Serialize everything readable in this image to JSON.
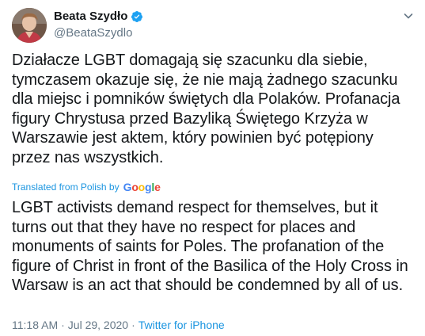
{
  "author": {
    "display_name": "Beata Szydło",
    "handle": "@BeataSzydlo"
  },
  "tweet": {
    "original_text": "Działacze LGBT domagają się szacunku dla siebie,\ntymczasem okazuje się, że nie mają żadnego szacunku\ndla miejsc i pomników świętych dla Polaków.   Profanacja\nfigury Chrystusa przed Bazyliką Świętego Krzyża w\nWarszawie jest aktem, który powinien być potępiony\nprzez nas wszystkich.",
    "translated_label": "Translated from Polish by",
    "translator_brand": "Google",
    "translated_text": "LGBT activists demand respect for themselves, but it\nturns out that they have no respect for places and\nmonuments of saints for Poles. The profanation of the\nfigure of Christ in front of the Basilica of the Holy Cross in\nWarsaw is an act that should be condemned by all of us.",
    "time": "11:18 AM",
    "separator": "·",
    "date": "Jul 29, 2020",
    "source": "Twitter for iPhone"
  },
  "icons": {
    "verified": "verified-badge-icon",
    "more": "chevron-down-icon"
  },
  "colors": {
    "link": "#1b95e0",
    "verified": "#1da1f2",
    "secondary_text": "#657786",
    "primary_text": "#14171a"
  }
}
